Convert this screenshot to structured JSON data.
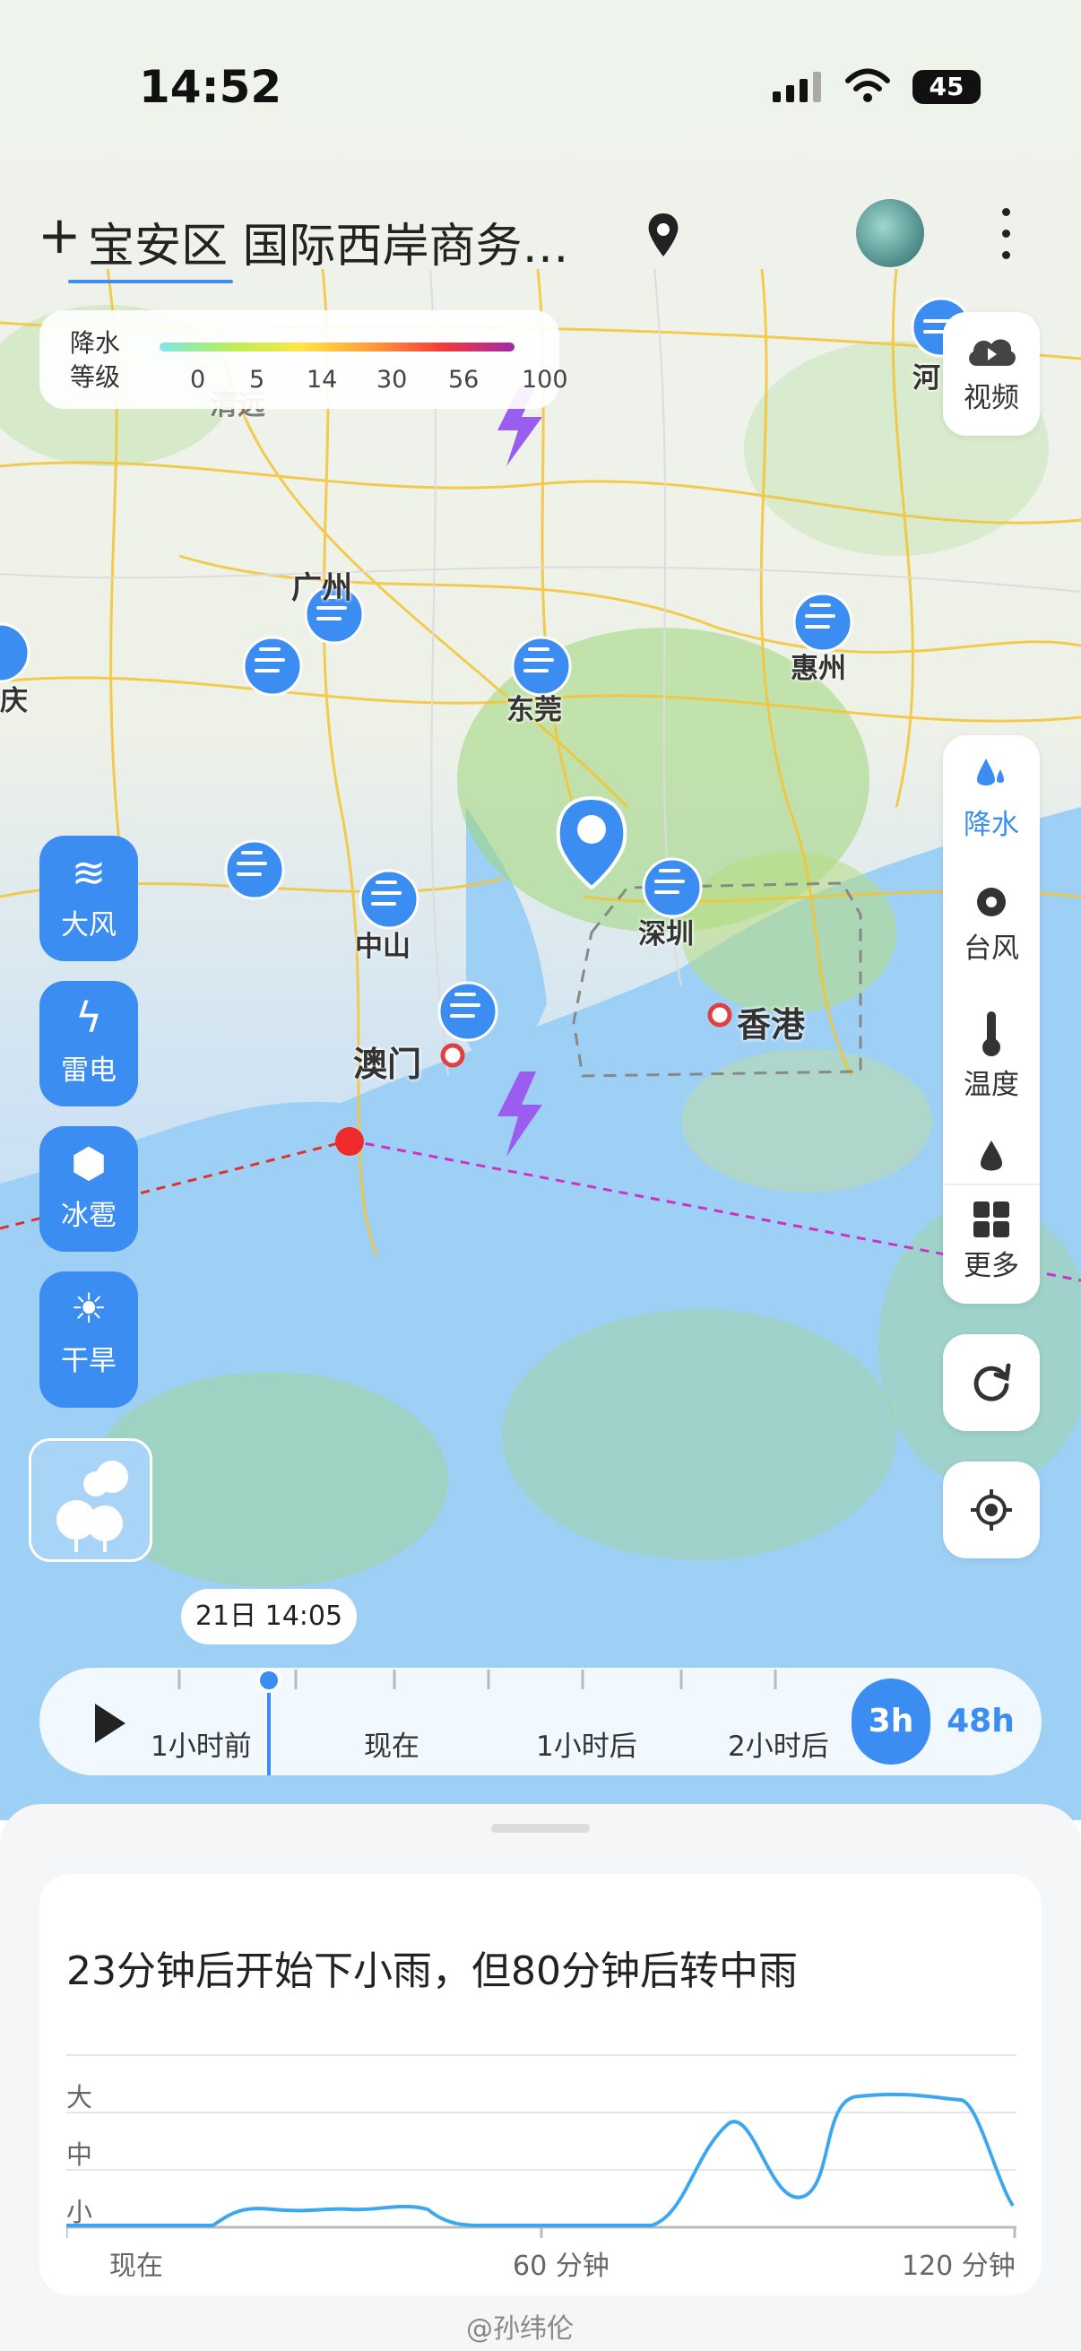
{
  "status_bar": {
    "time": "14:52",
    "battery": "45"
  },
  "header": {
    "location": "宝安区 国际西岸商务…",
    "plus": "+"
  },
  "legend": {
    "title_line1": "降水",
    "title_line2": "等级",
    "levels": [
      "0",
      "5",
      "14",
      "30",
      "56",
      "100"
    ]
  },
  "map": {
    "cities": [
      {
        "name": "广州"
      },
      {
        "name": "东莞"
      },
      {
        "name": "惠州"
      },
      {
        "name": "中山"
      },
      {
        "name": "深圳"
      },
      {
        "name": "澳门"
      },
      {
        "name": "香港"
      },
      {
        "name": "清远"
      },
      {
        "name": "河"
      },
      {
        "name": "庆"
      }
    ]
  },
  "right_panel": {
    "video": "视频",
    "layers": [
      "降水",
      "台风",
      "温度"
    ],
    "more": "更多"
  },
  "left_panel": {
    "buttons": [
      "大风",
      "雷电",
      "冰雹",
      "干旱"
    ]
  },
  "timeline": {
    "bubble": "21日 14:05",
    "ticks": [
      "1小时前",
      "现在",
      "1小时后",
      "2小时后"
    ],
    "mode_3h": "3h",
    "mode_48h": "48h"
  },
  "forecast": {
    "summary": "23分钟后开始下小雨，但80分钟后转中雨",
    "y_labels": [
      "大",
      "中",
      "小"
    ],
    "x_labels": [
      "现在",
      "60 分钟",
      "120 分钟"
    ]
  },
  "watermark": "@孙纬伦",
  "colors": {
    "accent": "#3b8df2",
    "wind_pin": "#3b8df2",
    "storm": "#9b5cf0"
  }
}
